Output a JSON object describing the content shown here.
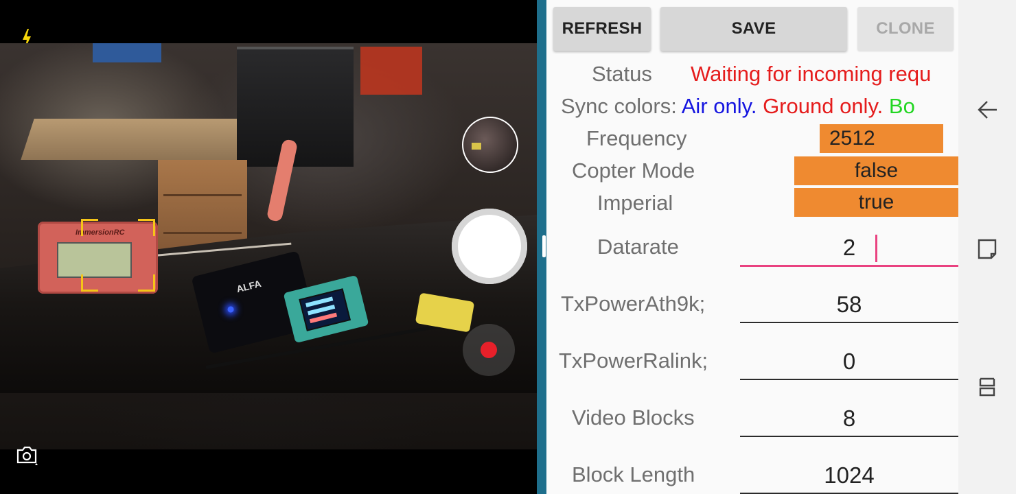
{
  "toolbar": {
    "refresh_label": "REFRESH",
    "save_label": "SAVE",
    "clone_label": "CLONE"
  },
  "status": {
    "label": "Status",
    "value": "Waiting for incoming requ"
  },
  "sync_colors": {
    "label": "Sync colors:",
    "air": "Air only.",
    "ground": "Ground only.",
    "both": "Bo",
    "air_color": "#1515e0",
    "ground_color": "#e51c1c",
    "both_color": "#22d622"
  },
  "settings": {
    "frequency": {
      "label": "Frequency",
      "value": "2512"
    },
    "copter_mode": {
      "label": "Copter Mode",
      "value": "false"
    },
    "imperial": {
      "label": "Imperial",
      "value": "true"
    },
    "datarate": {
      "label": "Datarate",
      "value": "2"
    },
    "txpower_ath9k": {
      "label": "TxPowerAth9k;",
      "value": "58"
    },
    "txpower_ralink": {
      "label": "TxPowerRalink;",
      "value": "0"
    },
    "video_blocks": {
      "label": "Video Blocks",
      "value": "8"
    },
    "block_length": {
      "label": "Block Length",
      "value": "1024"
    }
  },
  "camera": {
    "flash_icon": "lightning-icon",
    "switch_icon": "switch-camera-icon"
  },
  "colors": {
    "orange_field": "#ef8a30",
    "divider": "#1e6f8c",
    "active_underline": "#e94280"
  },
  "navigation": {
    "back_icon": "back-arrow-icon",
    "recents_icon": "recent-apps-icon",
    "home_icon": "overview-icon"
  }
}
